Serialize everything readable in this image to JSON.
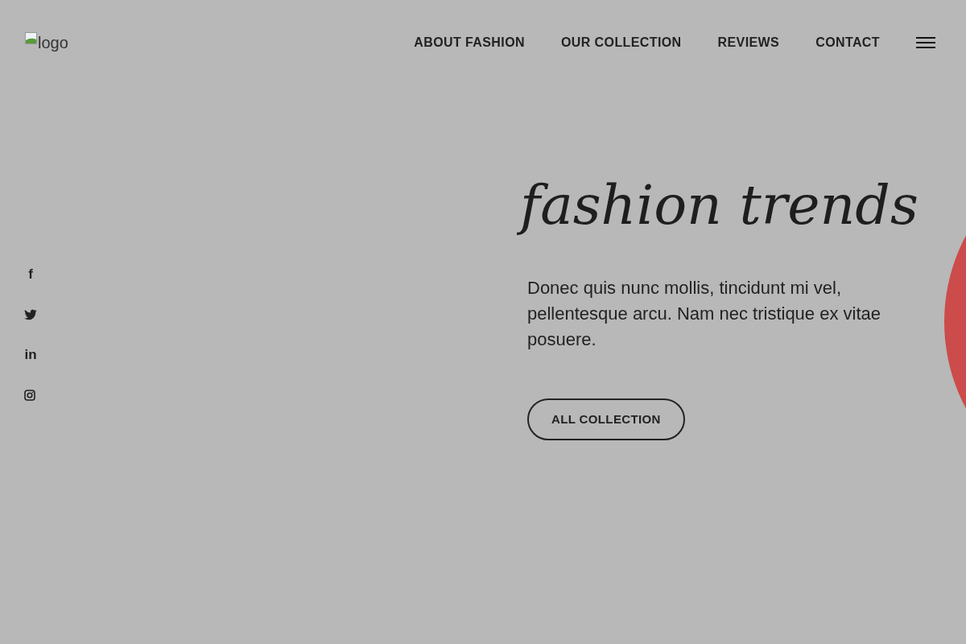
{
  "logo": {
    "alt_text": "logo"
  },
  "nav": [
    {
      "label": "ABOUT FASHION"
    },
    {
      "label": "OUR COLLECTION"
    },
    {
      "label": "REVIEWS"
    },
    {
      "label": "CONTACT"
    }
  ],
  "social": [
    {
      "kind": "text",
      "glyph": "f"
    },
    {
      "kind": "bird"
    },
    {
      "kind": "text",
      "glyph": "in"
    },
    {
      "kind": "camera"
    }
  ],
  "hero": {
    "title": "fashion trends",
    "text": "Donec quis nunc mollis, tincidunt mi vel, pellentesque arcu. Nam nec tristique ex vitae posuere.",
    "button": "ALL COLLECTION"
  }
}
